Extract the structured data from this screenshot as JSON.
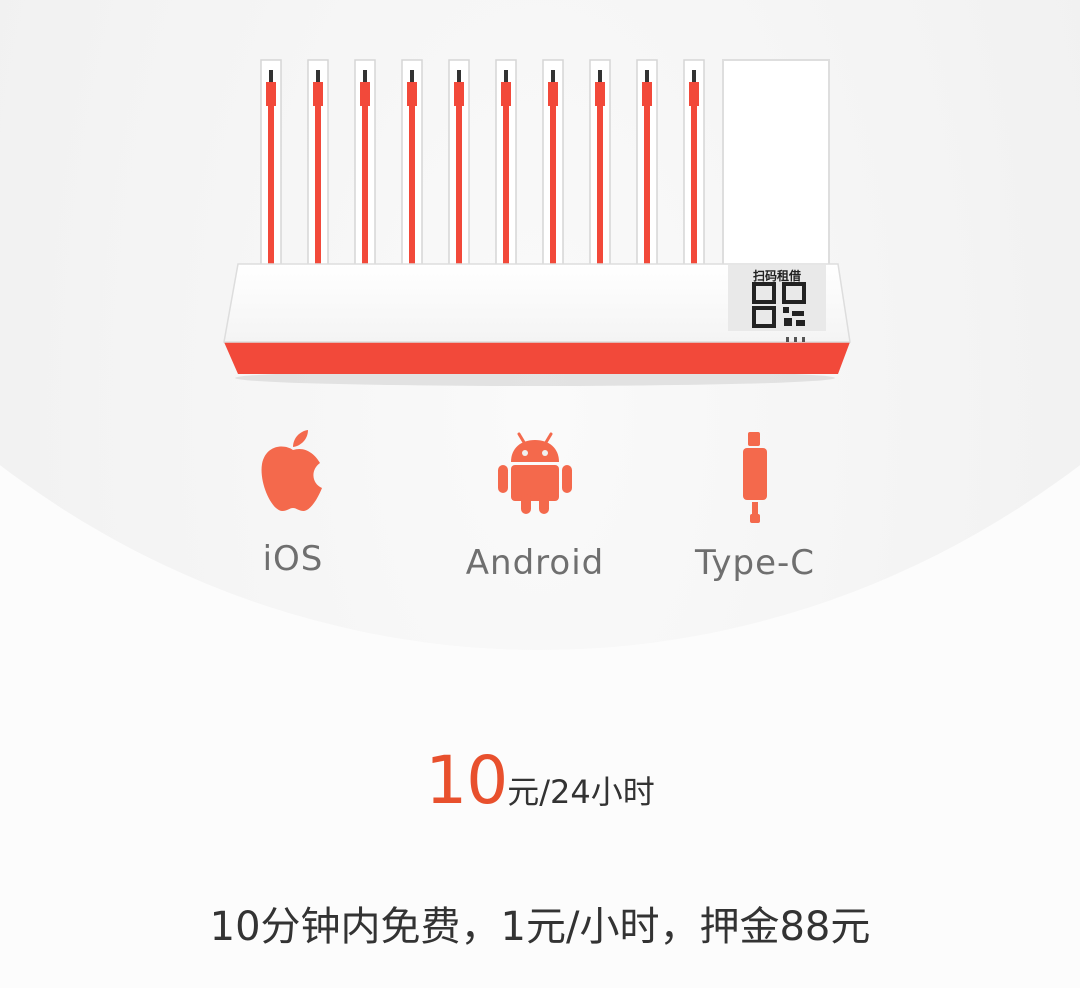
{
  "illustration": {
    "qr_caption": "扫码租借",
    "accent_color": "#f2493a",
    "icon_color": "#f4694c"
  },
  "features": [
    {
      "label": "iOS",
      "icon": "apple-icon"
    },
    {
      "label": "Android",
      "icon": "android-icon"
    },
    {
      "label": "Type-C",
      "icon": "usb-c-cable-icon"
    }
  ],
  "pricing": {
    "amount": "10",
    "unit": "元/24小时",
    "note": "10分钟内免费，1元/小时，押金88元"
  }
}
